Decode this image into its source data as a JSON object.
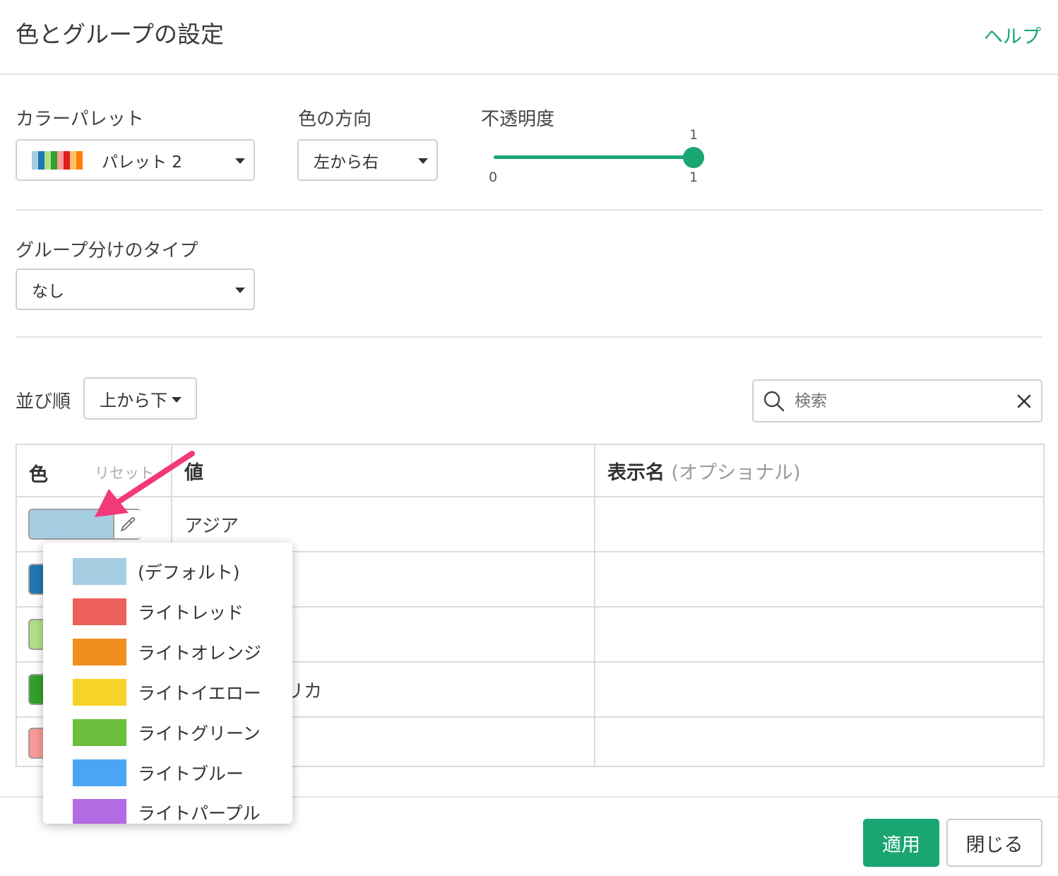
{
  "dialog": {
    "title": "色とグループの設定",
    "help": "ヘルプ"
  },
  "palette": {
    "label": "カラーパレット",
    "value": "パレット 2",
    "preview_colors": [
      "#a6cee3",
      "#1f78b4",
      "#b2df8a",
      "#33a02c",
      "#fb9a99",
      "#e31a1c",
      "#fdbf6f",
      "#ff7f00"
    ]
  },
  "direction": {
    "label": "色の方向",
    "value": "左から右"
  },
  "opacity": {
    "label": "不透明度",
    "value_label": "1",
    "min_label": "0",
    "max_label": "1",
    "value": 1
  },
  "grouping": {
    "label": "グループ分けのタイプ",
    "value": "なし"
  },
  "sort": {
    "label": "並び順",
    "value": "上から下"
  },
  "search": {
    "placeholder": "検索"
  },
  "table": {
    "headers": {
      "color": "色",
      "reset": "リセット",
      "value": "値",
      "display_name": "表示名",
      "display_name_hint": "(オプショナル)"
    },
    "rows": [
      {
        "color": "#a6cee3",
        "value": "アジア"
      },
      {
        "color": "#1f78b4",
        "value": ""
      },
      {
        "color": "#b2df8a",
        "value": ""
      },
      {
        "color": "#33a02c",
        "value": "リカ"
      },
      {
        "color": "#fb9a99",
        "value": ""
      }
    ]
  },
  "color_menu": {
    "options": [
      {
        "label": "(デフォルト)",
        "color": "#a6cee3"
      },
      {
        "label": "ライトレッド",
        "color": "#ec5f5a"
      },
      {
        "label": "ライトオレンジ",
        "color": "#f28e1c"
      },
      {
        "label": "ライトイエロー",
        "color": "#f5d328"
      },
      {
        "label": "ライトグリーン",
        "color": "#6cbe3d"
      },
      {
        "label": "ライトブルー",
        "color": "#4aa6f5"
      },
      {
        "label": "ライトパープル",
        "color": "#b26be3"
      }
    ]
  },
  "footer": {
    "apply": "適用",
    "close": "閉じる"
  },
  "accent_color": "#1aa673",
  "annotation_arrow_color": "#f2397a"
}
